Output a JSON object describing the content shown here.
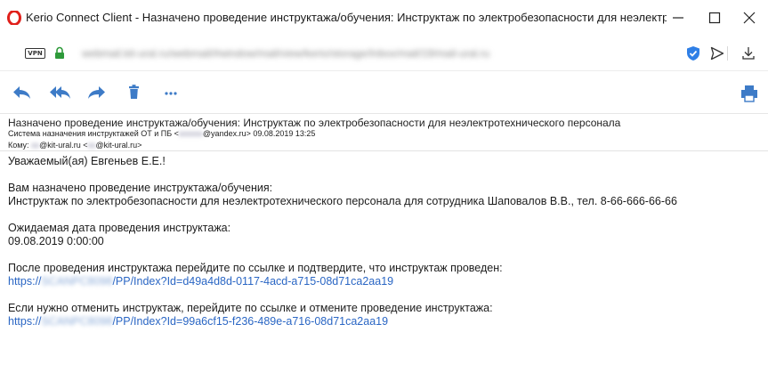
{
  "window": {
    "title": "Kerio Connect Client - Назначено проведение инструктажа/обучения: Инструктаж по электробезопасности для неэлектротехниче",
    "accent": "#e0201b"
  },
  "addressbar": {
    "vpn_label": "VPN",
    "url": "webmail.kit-ural.ru/webmail/#window/mail/view/kerio/storage/Inbox/mail/19/mail-ural.ru"
  },
  "toolbar": {
    "icons": [
      "reply-icon",
      "reply-all-icon",
      "forward-icon",
      "delete-icon",
      "more-icon",
      "print-icon"
    ]
  },
  "message": {
    "subject": "Назначено проведение инструктажа/обучения: Инструктаж по электробезопасности для неэлектротехнического персонала",
    "from_name": "Система назначения инструктажей ОТ и ПБ",
    "from_open": "<",
    "from_email_hidden": "xxxxxx",
    "from_email_domain": "@yandex.ru",
    "from_close": ">",
    "date": "09.08.2019 13:25",
    "to_label": "Кому:",
    "to_name_hidden": "xx",
    "to_name_domain": "@kit-ural.ru",
    "to_open": "<",
    "to_email_hidden": "xx",
    "to_email_domain": "@kit-ural.ru",
    "to_close": ">",
    "body": {
      "greeting": "Уважаемый(ая) Евгеньев Е.Е.!",
      "assigned_intro": "Вам назначено проведение инструктажа/обучения:",
      "assigned_detail": "Инструктаж по электробезопасности для неэлектротехнического персонала для сотрудника Шаповалов В.В., тел. 8-66-666-66-66",
      "date_label": "Ожидаемая дата проведения инструктажа:",
      "date_value": "09.08.2019 0:00:00",
      "confirm_text": "После проведения инструктажа перейдите по ссылке и подтвердите, что инструктаж проведен:",
      "confirm_link_prefix": "https://",
      "confirm_link_hidden": "SCANPC8098",
      "confirm_link_suffix": "/PP/Index?Id=d49a4d8d-0117-4acd-a715-08d71ca2aa19",
      "cancel_text": "Если нужно отменить инструктаж, перейдите по ссылке и отмените проведение инструктажа:",
      "cancel_link_prefix": "https://",
      "cancel_link_hidden": "SCANPC8098",
      "cancel_link_suffix": "/PP/Index?Id=99a6cf15-f236-489e-a716-08d71ca2aa19"
    }
  },
  "colors": {
    "icon_blue": "#3d7bc7",
    "link": "#2a66c4",
    "lock_green": "#2e9a3a",
    "shield_blue": "#2f7fe6"
  }
}
